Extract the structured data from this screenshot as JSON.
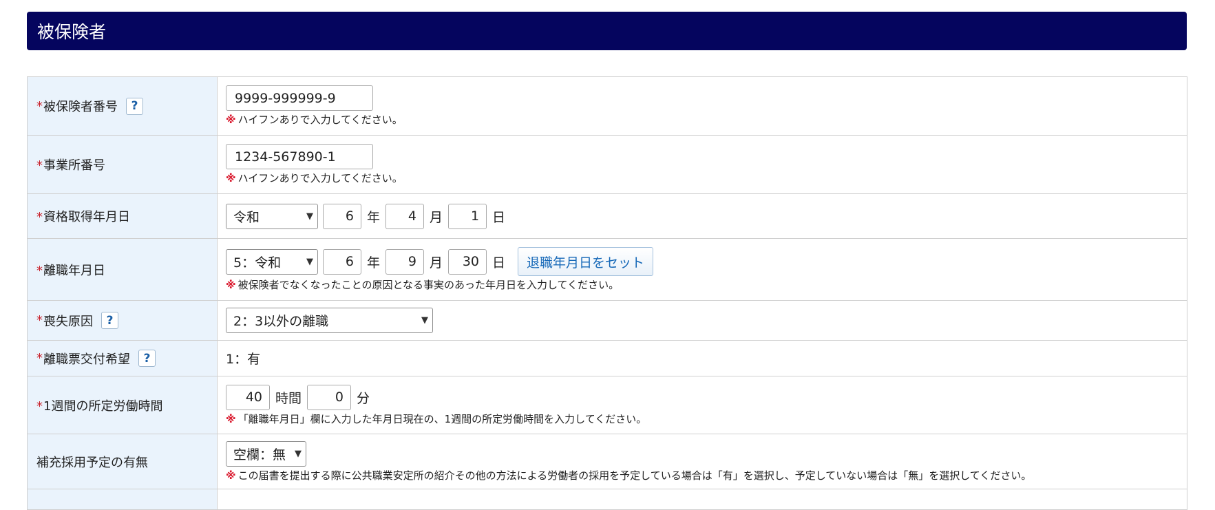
{
  "section": {
    "title": "被保険者"
  },
  "required_mark": "*",
  "note_mark": "※",
  "help_label": "?",
  "rows": {
    "insured_number": {
      "label": "被保険者番号",
      "value": "9999-999999-9",
      "note": "ハイフンありで入力してください。"
    },
    "office_number": {
      "label": "事業所番号",
      "value": "1234-567890-1",
      "note": "ハイフンありで入力してください。"
    },
    "qualification_date": {
      "label": "資格取得年月日",
      "era": "令和",
      "year": "6",
      "month": "4",
      "day": "1"
    },
    "separation_date": {
      "label": "離職年月日",
      "era": "5：令和",
      "year": "6",
      "month": "9",
      "day": "30",
      "button": "退職年月日をセット",
      "note": "被保険者でなくなったことの原因となる事実のあった年月日を入力してください。"
    },
    "loss_reason": {
      "label": "喪失原因",
      "value": "2：3以外の離職"
    },
    "separation_slip": {
      "label": "離職票交付希望",
      "value": "1：有"
    },
    "weekly_hours": {
      "label": "1週間の所定労働時間",
      "hours": "40",
      "minutes": "0",
      "note": "「離職年月日」欄に入力した年月日現在の、1週間の所定労働時間を入力してください。"
    },
    "replacement_hiring": {
      "label": "補充採用予定の有無",
      "value": "空欄：無",
      "note": "この届書を提出する際に公共職業安定所の紹介その他の方法による労働者の採用を予定している場合は「有」を選択し、予定していない場合は「無」を選択してください。"
    }
  },
  "units": {
    "year": "年",
    "month": "月",
    "day": "日",
    "hours": "時間",
    "minutes": "分"
  },
  "icons": {
    "select_arrow": "chevron-down-icon",
    "help": "help-icon"
  },
  "colors": {
    "header_bg": "#05055e",
    "label_bg": "#eaf3fc",
    "required": "#c8202a",
    "note_mark": "#d9162b",
    "button_text": "#1769b8"
  }
}
